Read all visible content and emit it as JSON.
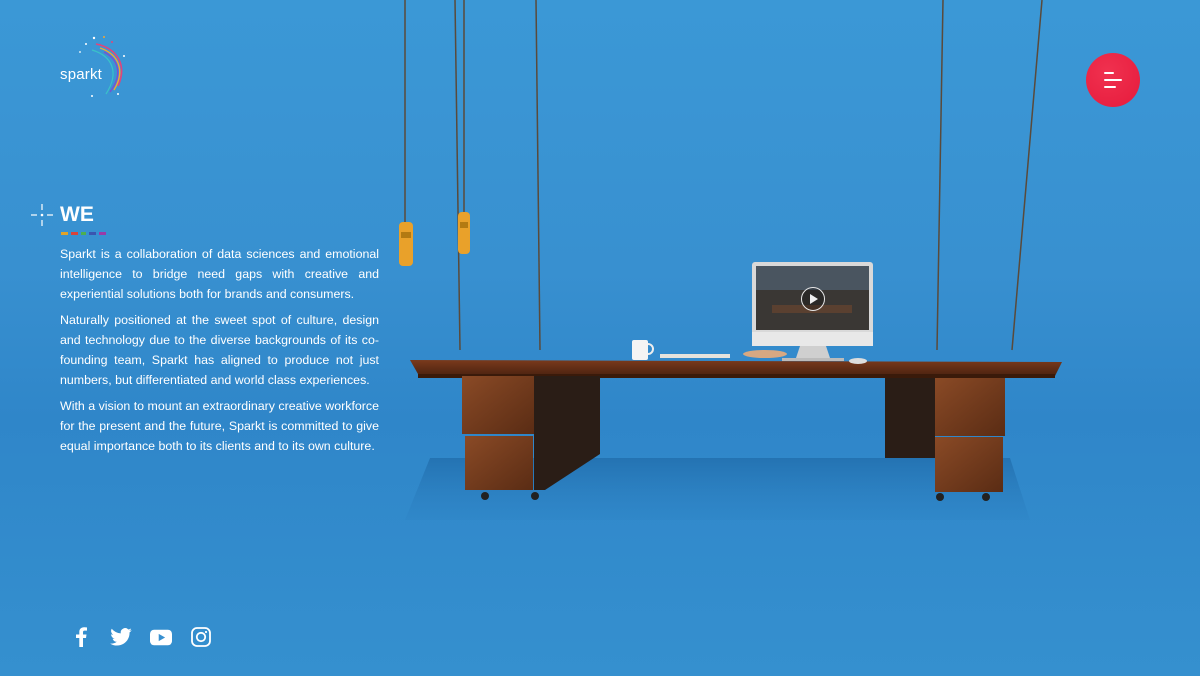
{
  "brand": {
    "logo_text": "sparkt"
  },
  "menu": {
    "icon": "hamburger-menu-icon",
    "color": "#e61a3c"
  },
  "section": {
    "title": "WE",
    "accent_colors": [
      "#e0a32a",
      "#d8443b",
      "#4caf50",
      "#3a56b0",
      "#9a3aa8"
    ],
    "paragraphs": [
      "Sparkt is a collaboration of data sciences and emotional intelligence to bridge need gaps with creative and experiential solutions both for brands and consumers.",
      "Naturally positioned at the sweet spot of culture, design and technology due to the diverse backgrounds of its co-founding team, Sparkt has aligned to produce not just numbers, but differentiated and world class experiences.",
      "With a vision to mount an extraordinary creative workforce for the present and the future, Sparkt is committed to give equal importance both to its clients and to its own culture."
    ]
  },
  "social": [
    "facebook-icon",
    "twitter-icon",
    "youtube-icon",
    "instagram-icon"
  ],
  "colors": {
    "background": "#3890d0",
    "accent": "#e61a3c"
  }
}
